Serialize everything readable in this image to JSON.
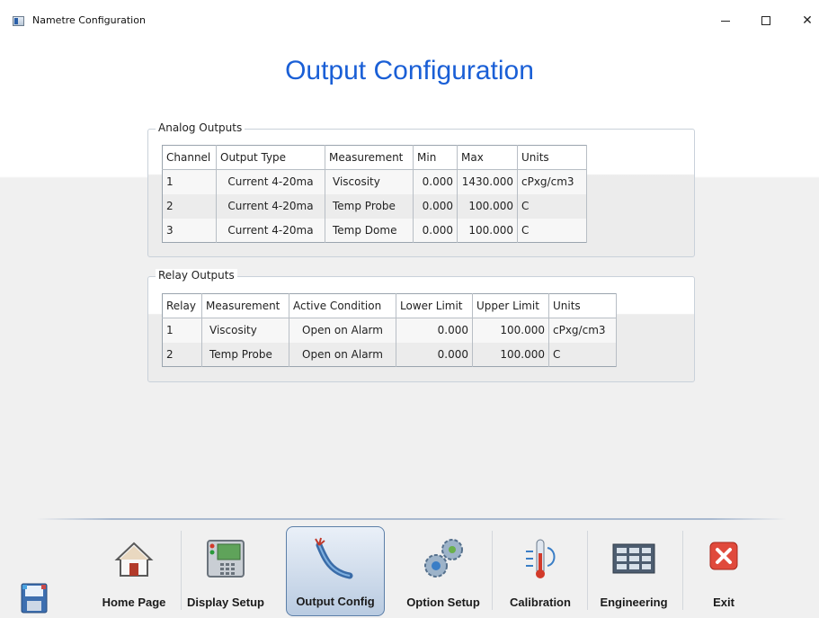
{
  "window": {
    "title": "Nametre Configuration",
    "icon": "app-window-icon",
    "controls": {
      "minimize": "minimize-icon",
      "maximize": "maximize-icon",
      "close_glyph": "✕"
    }
  },
  "page": {
    "title": "Output Configuration"
  },
  "analog": {
    "label": "Analog Outputs",
    "headers": {
      "channel": "Channel",
      "output_type": "Output Type",
      "measurement": "Measurement",
      "min": "Min",
      "max": "Max",
      "units": "Units"
    },
    "rows": [
      {
        "channel": "1",
        "output_type": "Current 4-20ma",
        "measurement": "Viscosity",
        "min": "0.000",
        "max": "1430.000",
        "units": "cPxg/cm3"
      },
      {
        "channel": "2",
        "output_type": "Current 4-20ma",
        "measurement": "Temp Probe",
        "min": "0.000",
        "max": "100.000",
        "units": "C"
      },
      {
        "channel": "3",
        "output_type": "Current 4-20ma",
        "measurement": "Temp Dome",
        "min": "0.000",
        "max": "100.000",
        "units": "C"
      }
    ]
  },
  "relay": {
    "label": "Relay Outputs",
    "headers": {
      "relay": "Relay",
      "measurement": "Measurement",
      "active_condition": "Active Condition",
      "lower_limit": "Lower Limit",
      "upper_limit": "Upper Limit",
      "units": "Units"
    },
    "rows": [
      {
        "relay": "1",
        "measurement": "Viscosity",
        "active_condition": "Open on Alarm",
        "lower_limit": "0.000",
        "upper_limit": "100.000",
        "units": "cPxg/cm3"
      },
      {
        "relay": "2",
        "measurement": "Temp Probe",
        "active_condition": "Open on Alarm",
        "lower_limit": "0.000",
        "upper_limit": "100.000",
        "units": "C"
      }
    ]
  },
  "nav": {
    "items": [
      {
        "label": "Home Page",
        "icon": "home-icon"
      },
      {
        "label": "Display Setup",
        "icon": "display-panel-icon"
      },
      {
        "label": "Output Config",
        "icon": "cable-icon",
        "active": true
      },
      {
        "label": "Option Setup",
        "icon": "gears-icon"
      },
      {
        "label": "Calibration",
        "icon": "thermometer-icon"
      },
      {
        "label": "Engineering",
        "icon": "grid-panel-icon"
      },
      {
        "label": "Exit",
        "icon": "exit-x-icon"
      }
    ]
  },
  "colors": {
    "title_blue": "#1a5fd6",
    "active_nav": "#b9cbe1",
    "exit_red": "#e04a3c"
  }
}
